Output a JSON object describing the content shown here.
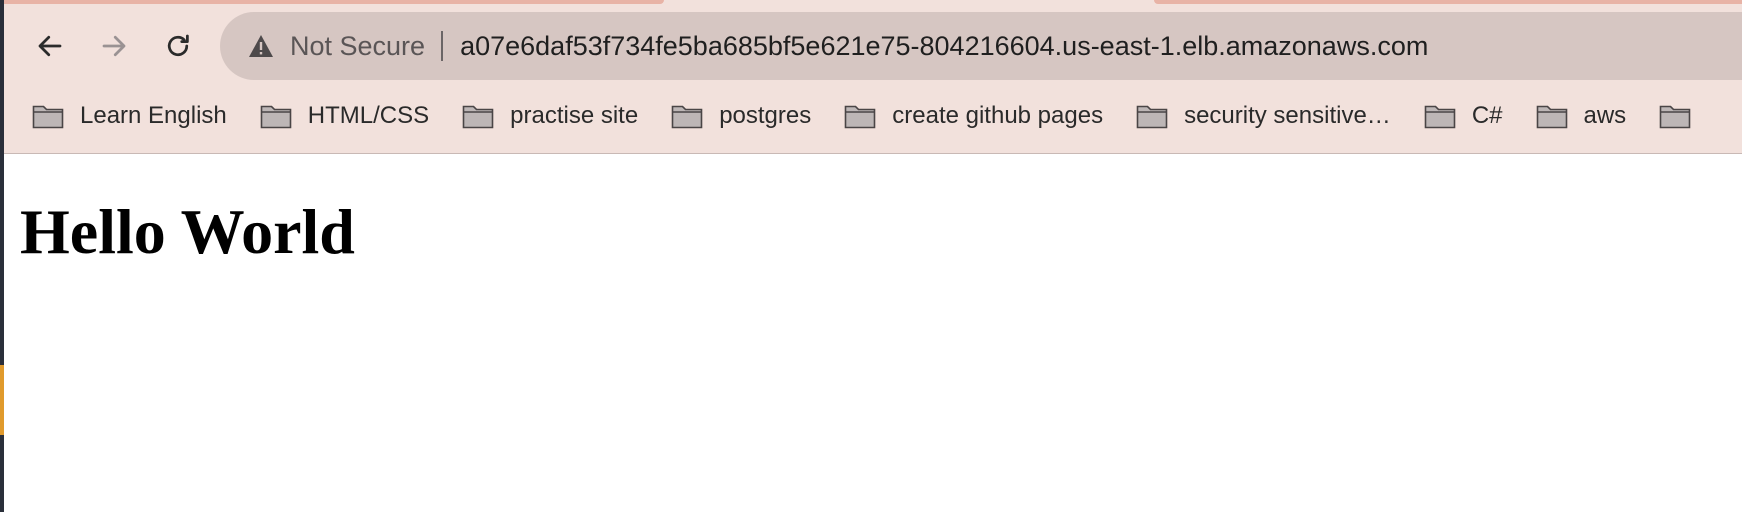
{
  "toolbar": {
    "back_icon": "arrow-left-icon",
    "forward_icon": "arrow-right-icon",
    "reload_icon": "reload-icon"
  },
  "omnibox": {
    "security_icon": "warning-triangle-icon",
    "security_label": "Not Secure",
    "url": "a07e6daf53f734fe5ba685bf5e621e75-804216604.us-east-1.elb.amazonaws.com"
  },
  "bookmarks": [
    {
      "label": "Learn English"
    },
    {
      "label": "HTML/CSS"
    },
    {
      "label": "practise site"
    },
    {
      "label": "postgres"
    },
    {
      "label": "create github pages"
    },
    {
      "label": "security sensitive…"
    },
    {
      "label": "C#"
    },
    {
      "label": "aws"
    }
  ],
  "page": {
    "heading": "Hello World"
  },
  "colors": {
    "chrome_bg": "#f2e1dc",
    "omnibox_bg": "#d6c6c2",
    "tab_accent": "#e8b3a6",
    "folder_fill": "#bdb6b6"
  }
}
